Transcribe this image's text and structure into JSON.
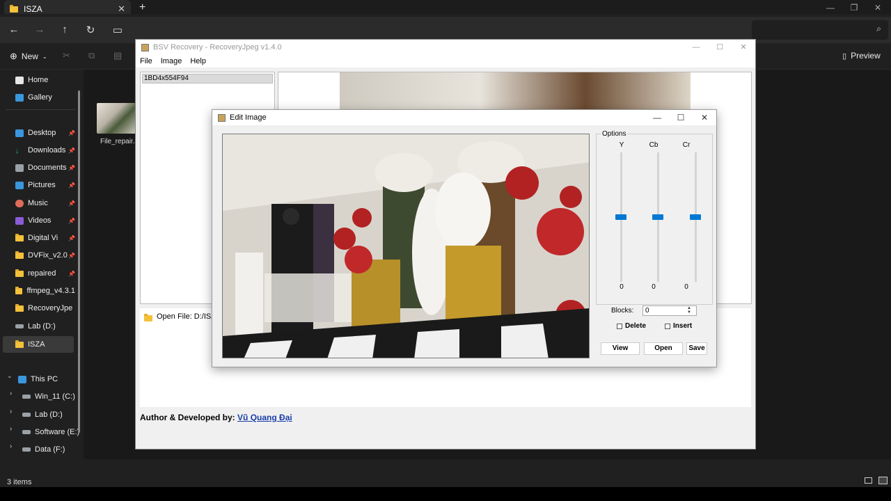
{
  "explorer": {
    "tab_title": "ISZA",
    "new_label": "New",
    "preview_label": "Preview",
    "status": "3 items",
    "file_label": "File_repair.JF",
    "nav": [
      {
        "label": "Home",
        "icon": "home-icon"
      },
      {
        "label": "Gallery",
        "icon": "gallery-icon"
      },
      {
        "label": "Desktop",
        "icon": "desktop-icon",
        "pinned": true
      },
      {
        "label": "Downloads",
        "icon": "download-icon",
        "pinned": true
      },
      {
        "label": "Documents",
        "icon": "document-icon",
        "pinned": true
      },
      {
        "label": "Pictures",
        "icon": "pictures-icon",
        "pinned": true
      },
      {
        "label": "Music",
        "icon": "music-icon",
        "pinned": true
      },
      {
        "label": "Videos",
        "icon": "videos-icon",
        "pinned": true
      },
      {
        "label": "Digital Vi",
        "icon": "folder-icon",
        "pinned": true
      },
      {
        "label": "DVFix_v2.0",
        "icon": "folder-icon",
        "pinned": true
      },
      {
        "label": "repaired",
        "icon": "folder-icon",
        "pinned": true
      },
      {
        "label": "ffmpeg_v4.3.1",
        "icon": "folder-icon"
      },
      {
        "label": "RecoveryJpe",
        "icon": "folder-icon"
      },
      {
        "label": "Lab (D:)",
        "icon": "drive-icon"
      },
      {
        "label": "ISZA",
        "icon": "folder-icon",
        "selected": true
      },
      {
        "label": "This PC",
        "icon": "pc-icon"
      },
      {
        "label": "Win_11 (C:)",
        "icon": "drive-icon"
      },
      {
        "label": "Lab (D:)",
        "icon": "drive-icon"
      },
      {
        "label": "Software (E:)",
        "icon": "drive-icon"
      },
      {
        "label": "Data (F:)",
        "icon": "drive-icon"
      }
    ]
  },
  "bsv": {
    "title": "BSV Recovery - RecoveryJpeg v1.4.0",
    "menu": [
      "File",
      "Image",
      "Help"
    ],
    "list_item": "1BD4x554F94",
    "open_file": "Open File: D:/ISZA/",
    "author_prefix": "Author & Developed by:",
    "author_name": "Vũ Quang Đại"
  },
  "edit": {
    "title": "Edit Image",
    "options_label": "Options",
    "channels": [
      {
        "label": "Y",
        "value": "0",
        "level": 0.5
      },
      {
        "label": "Cb",
        "value": "0",
        "level": 0.5
      },
      {
        "label": "Cr",
        "value": "0",
        "level": 0.5
      }
    ],
    "blocks_label": "Blocks:",
    "blocks_value": "0",
    "delete_label": "Delete",
    "insert_label": "Insert",
    "view_label": "View",
    "open_label": "Open",
    "save_label": "Save"
  },
  "colors": {
    "accent": "#0078d4",
    "link": "#1a3ea8"
  }
}
